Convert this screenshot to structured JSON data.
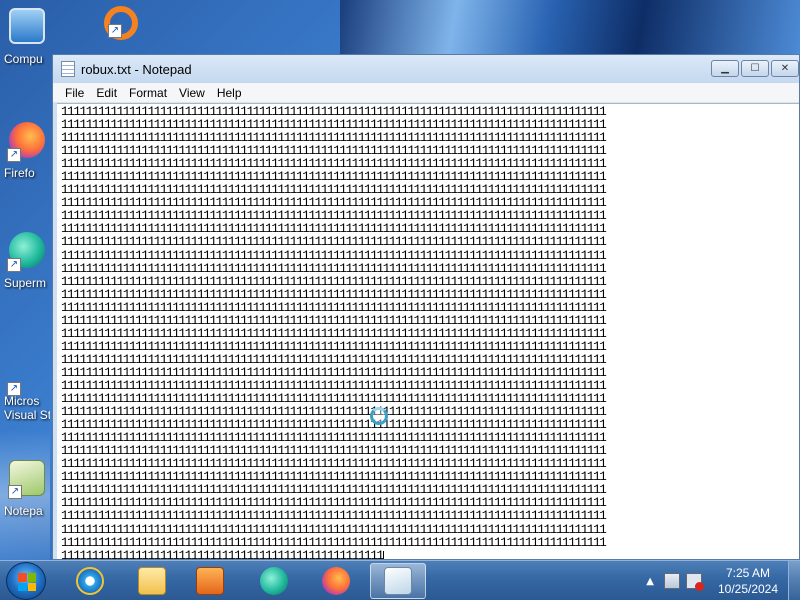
{
  "desktop": {
    "icons": [
      {
        "label": "Compu",
        "icon": "computer-icon"
      },
      {
        "label": "Firefo",
        "icon": "firefox-icon"
      },
      {
        "label": "Superm",
        "icon": "supermium-icon"
      },
      {
        "label": "Micros",
        "label2": "Visual St",
        "icon": "visual-studio-icon"
      },
      {
        "label": "Notepa",
        "icon": "notepad-icon"
      }
    ],
    "top_icon": "origin-icon"
  },
  "window": {
    "title": "robux.txt - Notepad",
    "menu": [
      "File",
      "Edit",
      "Format",
      "View",
      "Help"
    ],
    "controls": {
      "minimize": "▁",
      "maximize": "☐",
      "close": "✕"
    }
  },
  "editor": {
    "line_char": "1",
    "full_line_count": 34,
    "chars_per_line": 88,
    "last_line_chars": 52
  },
  "taskbar": {
    "apps": [
      "internet-explorer-icon",
      "file-explorer-icon",
      "media-player-icon",
      "supermium-icon",
      "firefox-icon",
      "notepad-icon"
    ],
    "active_app": "notepad-icon",
    "tray": {
      "show_hidden": "▲"
    },
    "clock": {
      "time": "7:25 AM",
      "date": "10/25/2024"
    }
  }
}
